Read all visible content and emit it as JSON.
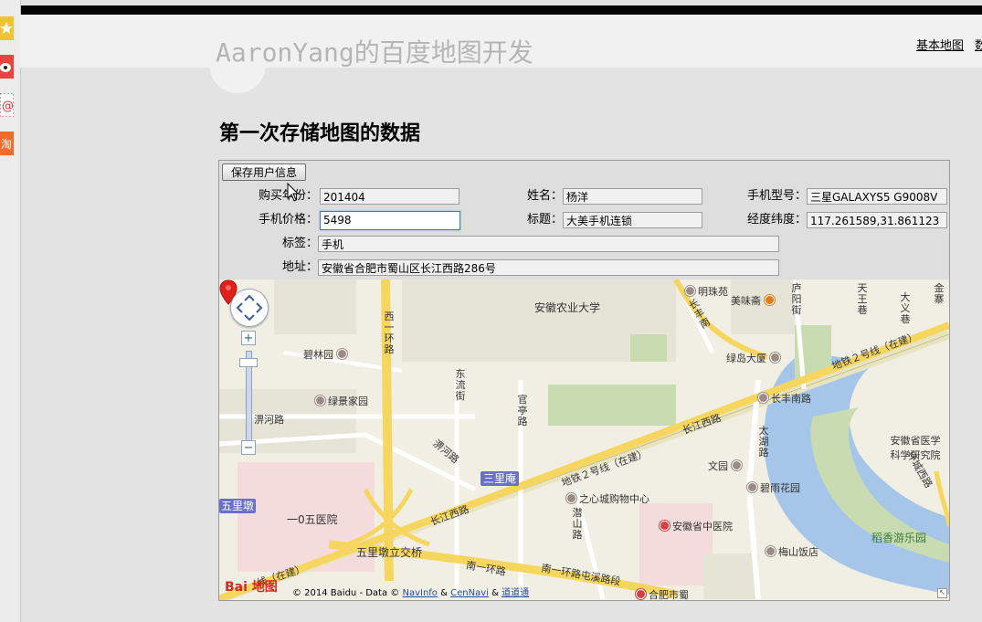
{
  "header": {
    "site_title": "AaronYang的百度地图开发",
    "nav": [
      "基本地图",
      "数"
    ]
  },
  "page_heading": "第一次存储地图的数据",
  "form": {
    "save_button": "保存用户信息",
    "fields": {
      "purchase_year": {
        "label": "购买年份：",
        "value": "201404"
      },
      "name": {
        "label": "姓名：",
        "value": "杨洋"
      },
      "phone_model": {
        "label": "手机型号：",
        "value": "三星GALAXYS5 G9008V"
      },
      "phone_price": {
        "label": "手机价格：",
        "value": "5498"
      },
      "title": {
        "label": "标题：",
        "value": "大美手机连锁"
      },
      "lnglat": {
        "label": "经度纬度：",
        "value": "117.261589,31.861123"
      },
      "tags": {
        "label": "标签：",
        "value": "手机"
      },
      "address": {
        "label": "地址：",
        "value": "安徽省合肥市蜀山区长江西路286号"
      }
    }
  },
  "map": {
    "labels": {
      "anhui_agri_univ": "安徽农业大学",
      "bilinyuan": "碧林园",
      "lvjing": "绿景家园",
      "feihe_road": "淠河路",
      "feihe_road2": "淠河路",
      "sanli": "三里庵",
      "wulidun": "五里墩",
      "hospital105": "一0五医院",
      "wulidun_bridge": "五里墩立交桥",
      "changjiang_w": "长江西路",
      "changjiang_w2": "长江西路",
      "metro2": "地铁２号线（在建）",
      "metro2b": "地铁２号线（在建）",
      "metro2c": "线（在建）",
      "zhixin": "之心城购物中心",
      "anhui_tcm": "安徽省中医院",
      "wenyuan": "文园",
      "biyu": "碧雨花园",
      "meishan": "梅山饭店",
      "daoxiang": "稻香游乐园",
      "changfeng_s": "长丰南路",
      "lvdao": "绿岛大厦",
      "meiwei": "美味斋",
      "mingzhu": "明珠苑",
      "anhui_med": "安徽省医学科学研究院",
      "huancheng_w": "环城西路",
      "nanyi_ring": "南一环路",
      "nanyi_tunxi": "南一环路屯溪路段",
      "hefei_shu": "合肥市蜀",
      "xiyi_ring": "西一环路",
      "dongliu": "东流街",
      "guanting": "官亭路",
      "changjiang_n": "长丰南路",
      "changfeng": "长丰南",
      "luyang": "庐阳街",
      "tianwang": "天王巷",
      "dayi": "大义巷",
      "jinzhai": "金寨",
      "taihu": "太湖路",
      "qianshan": "潜山路"
    },
    "copyright_prefix": "© 2014 Baidu - Data ©",
    "copyright_links": [
      "NavInfo",
      "CenNavi",
      "道道通"
    ],
    "copyright_sep": "&",
    "logo_text": "Bai 地图",
    "colors": {
      "background": "#f1efe3",
      "major_road": "#f7d65f",
      "minor_road": "#ffffff",
      "water": "#a6c6e9",
      "green": "#c9dcb1",
      "block": "#e6e4d6",
      "hospital_zone": "#f4dcdc",
      "metro_line": "#e9e4c0",
      "marker": "#e0201c",
      "station": "#6a6fc8"
    }
  }
}
